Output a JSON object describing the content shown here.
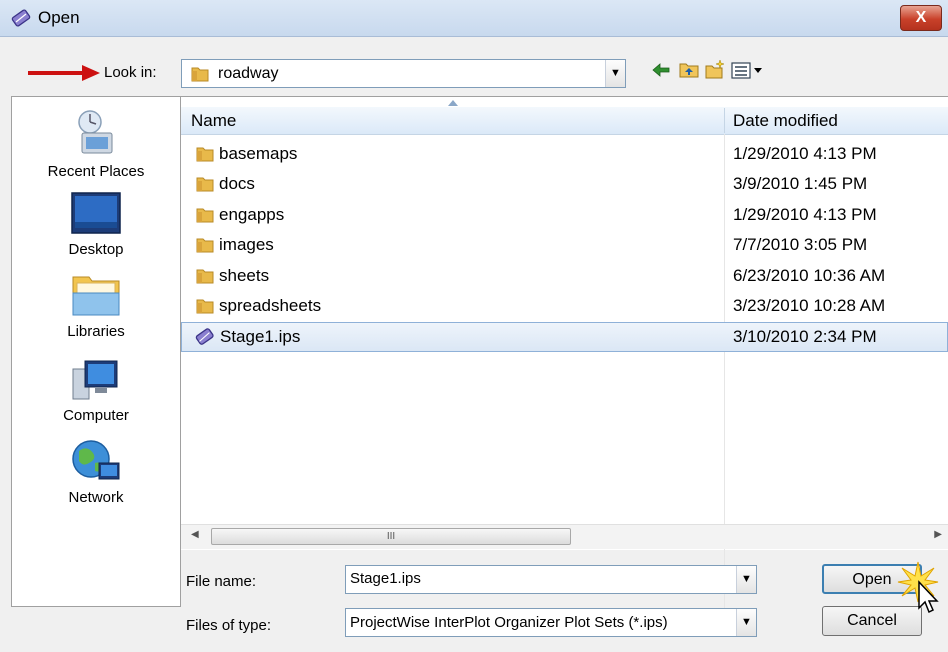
{
  "window": {
    "title": "Open",
    "close_label": "X"
  },
  "lookin": {
    "label": "Look in:",
    "value": "roadway"
  },
  "places": [
    {
      "label": "Recent Places",
      "icon": "recent-places-icon"
    },
    {
      "label": "Desktop",
      "icon": "desktop-icon"
    },
    {
      "label": "Libraries",
      "icon": "libraries-icon"
    },
    {
      "label": "Computer",
      "icon": "computer-icon"
    },
    {
      "label": "Network",
      "icon": "network-icon"
    }
  ],
  "columns": {
    "name": "Name",
    "date": "Date modified"
  },
  "files": [
    {
      "name": "basemaps",
      "date": "1/29/2010 4:13 PM",
      "icon": "folder-icon"
    },
    {
      "name": "docs",
      "date": "3/9/2010 1:45 PM",
      "icon": "folder-icon"
    },
    {
      "name": "engapps",
      "date": "1/29/2010 4:13 PM",
      "icon": "folder-icon"
    },
    {
      "name": "images",
      "date": "7/7/2010 3:05 PM",
      "icon": "folder-icon"
    },
    {
      "name": "sheets",
      "date": "6/23/2010 10:36 AM",
      "icon": "folder-icon"
    },
    {
      "name": "spreadsheets",
      "date": "3/23/2010 10:28 AM",
      "icon": "folder-icon"
    },
    {
      "name": "Stage1.ips",
      "date": "3/10/2010 2:34 PM",
      "icon": "ips-file-icon",
      "selected": true
    }
  ],
  "scrollbar": {
    "thumb_grip": "III"
  },
  "form": {
    "filename_label": "File name:",
    "filename_value": "Stage1.ips",
    "filetype_label": "Files of type:",
    "filetype_value": "ProjectWise InterPlot Organizer Plot Sets (*.ips)"
  },
  "buttons": {
    "open": "Open",
    "cancel": "Cancel"
  },
  "colors": {
    "selection": "#dbe7f5",
    "folder": "#e8b94a",
    "accent_arrow": "#cc1111"
  }
}
